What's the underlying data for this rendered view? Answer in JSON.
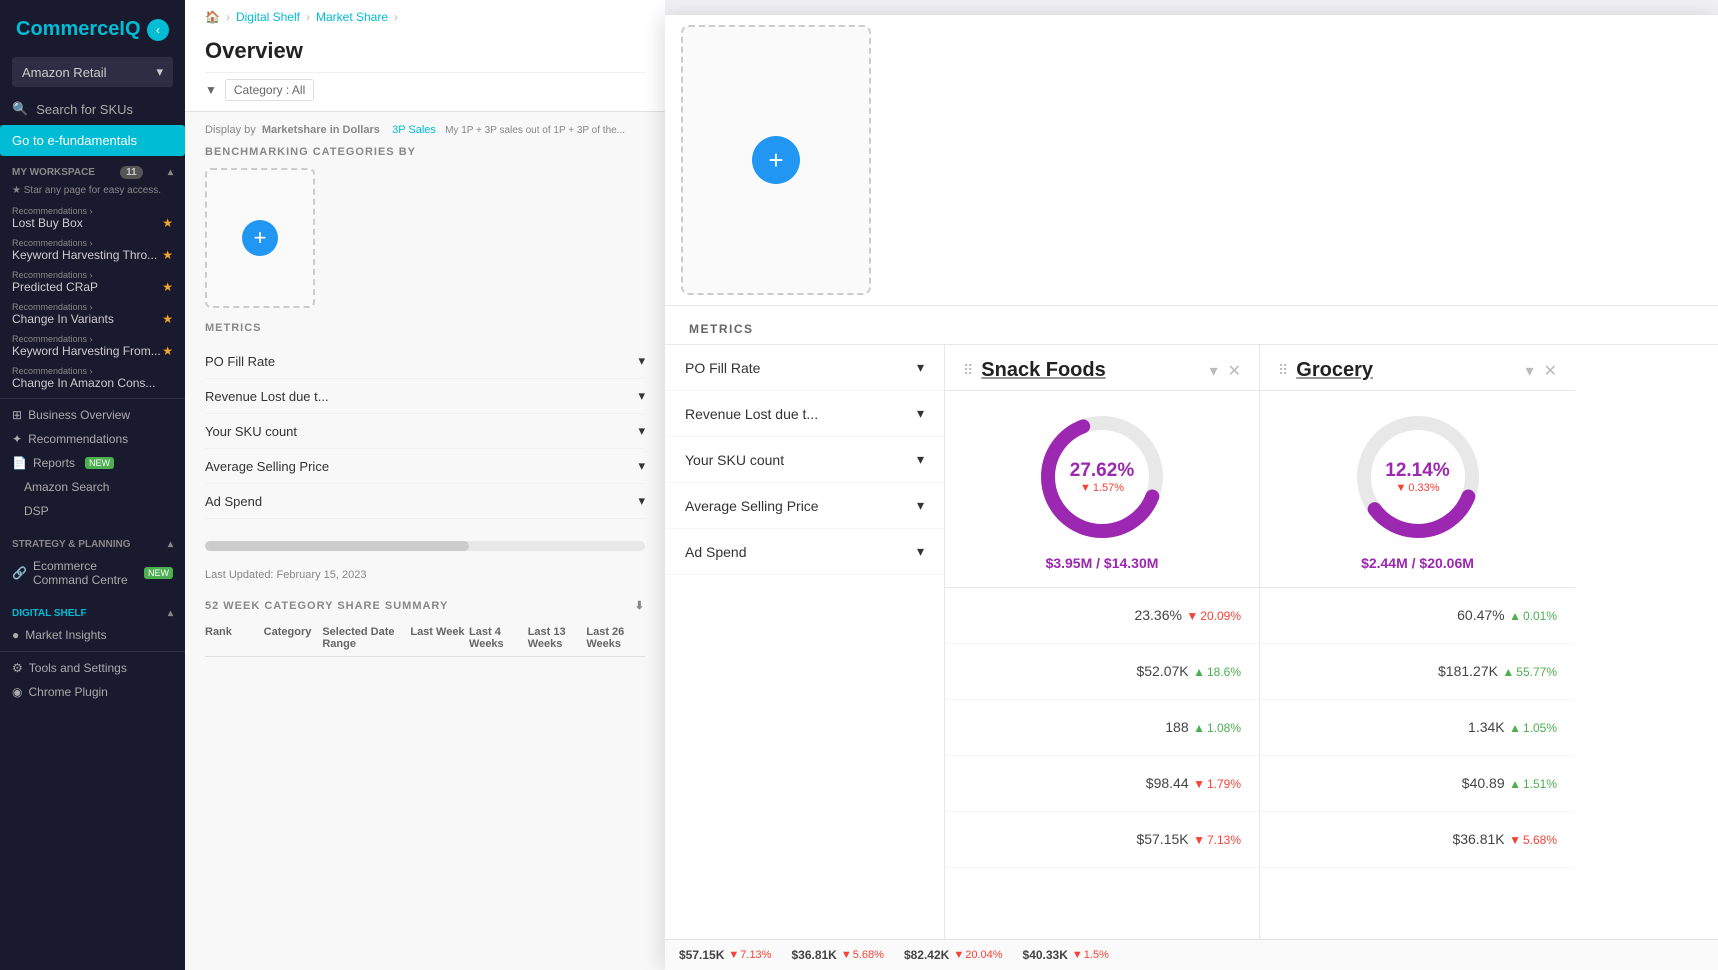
{
  "sidebar": {
    "logo": "Commerce",
    "logo_accent": "IQ",
    "retailer": "Amazon Retail",
    "search_label": "Search for SKUs",
    "efund_label": "Go to e-fundamentals",
    "workspace_label": "MY WORKSPACE",
    "workspace_count": "11",
    "star_hint": "★ Star any page for easy access.",
    "recommendations": [
      {
        "sub": "Recommendations ›",
        "name": "Lost Buy Box",
        "starred": true
      },
      {
        "sub": "Recommendations ›",
        "name": "Keyword Harvesting Thro...",
        "starred": true
      },
      {
        "sub": "Recommendations ›",
        "name": "Predicted CRaP",
        "starred": true
      },
      {
        "sub": "Recommendations ›",
        "name": "Change In Variants",
        "starred": true
      },
      {
        "sub": "Recommendations ›",
        "name": "Keyword Harvesting From...",
        "starred": true
      },
      {
        "sub": "Recommendations ›",
        "name": "Change In Amazon Cons...",
        "starred": false
      }
    ],
    "nav_items": [
      {
        "icon": "⊞",
        "label": "Business Overview"
      },
      {
        "icon": "★",
        "label": "Recommendations"
      },
      {
        "icon": "📄",
        "label": "Reports",
        "badge": "NEW"
      }
    ],
    "sub_items": [
      {
        "label": "Amazon Search"
      },
      {
        "label": "DSP"
      }
    ],
    "strategy_label": "STRATEGY & PLANNING",
    "ecommand": {
      "label": "Ecommerce Command Centre",
      "badge": "NEW"
    },
    "digital_shelf_label": "DIGITAL SHELF",
    "market_insights": "Market Insights",
    "tools_label": "Tools and Settings",
    "chrome_label": "Chrome Plugin"
  },
  "main": {
    "breadcrumb": [
      "🏠",
      "Digital Shelf",
      "Market Share"
    ],
    "page_title": "Overview",
    "filter_label": "Category : All",
    "display_text": "Display by  Marketshare in Dollars",
    "sales_text": "3P Sales  My 1P + 3P sales out of 1P + 3P of the...",
    "section_title": "BENCHMARKING CATEGORIES BY",
    "metrics_title": "METRICS",
    "metrics": [
      "PO Fill Rate",
      "Revenue Lost due t...",
      "Your SKU count",
      "Average Selling Price",
      "Ad Spend"
    ],
    "last_updated": "Last Updated: February 15, 2023",
    "summary_title": "52 WEEK CATEGORY SHARE SUMMARY",
    "table_headers": [
      "Rank",
      "Category",
      "Selected Date Range",
      "Last Week",
      "Last 4 Weeks",
      "Last 13 Weeks",
      "Last 26 Weeks"
    ],
    "bottom_metrics": [
      {
        "value": "$57.15K",
        "change": "7.13%",
        "dir": "down"
      },
      {
        "value": "$36.81K",
        "change": "5.68%",
        "dir": "down"
      },
      {
        "value": "$82.42K",
        "change": "20.04%",
        "dir": "down"
      },
      {
        "value": "$40.33K",
        "change": "1.5%",
        "dir": "down"
      }
    ]
  },
  "overlay": {
    "metrics_title": "METRICS",
    "metrics_list": [
      "PO Fill Rate",
      "Revenue Lost due t...",
      "Your SKU count",
      "Average Selling Price",
      "Ad Spend"
    ],
    "categories": [
      {
        "name": "Snack Foods",
        "donut_pct": "27.62%",
        "donut_change": "1.57%",
        "donut_dir": "down",
        "donut_color": "#9c27b0",
        "revenue": "$3.95M / $14.30M",
        "metrics_data": [
          {
            "value": "23.36%",
            "change": "20.09%",
            "dir": "down"
          },
          {
            "value": "$52.07K",
            "change": "18.6%",
            "dir": "up"
          },
          {
            "value": "188",
            "change": "1.08%",
            "dir": "up"
          },
          {
            "value": "$98.44",
            "change": "1.79%",
            "dir": "down"
          },
          {
            "value": "$57.15K",
            "change": "7.13%",
            "dir": "down"
          }
        ]
      },
      {
        "name": "Grocery",
        "donut_pct": "12.14%",
        "donut_change": "0.33%",
        "donut_dir": "down",
        "donut_color": "#9c27b0",
        "revenue": "$2.44M / $20.06M",
        "metrics_data": [
          {
            "value": "60.47%",
            "change": "0.01%",
            "dir": "up"
          },
          {
            "value": "$181.27K",
            "change": "55.77%",
            "dir": "up"
          },
          {
            "value": "1.34K",
            "change": "1.05%",
            "dir": "up"
          },
          {
            "value": "$40.89",
            "change": "1.51%",
            "dir": "up"
          },
          {
            "value": "$36.81K",
            "change": "5.68%",
            "dir": "down"
          }
        ]
      }
    ],
    "bottom_bar": [
      {
        "value": "$57.15K",
        "change": "7.13%",
        "dir": "down"
      },
      {
        "value": "$36.81K",
        "change": "5.68%",
        "dir": "down"
      },
      {
        "value": "$82.42K",
        "change": "20.04%",
        "dir": "down"
      },
      {
        "value": "$40.33K",
        "change": "1.5%",
        "dir": "down"
      }
    ]
  }
}
